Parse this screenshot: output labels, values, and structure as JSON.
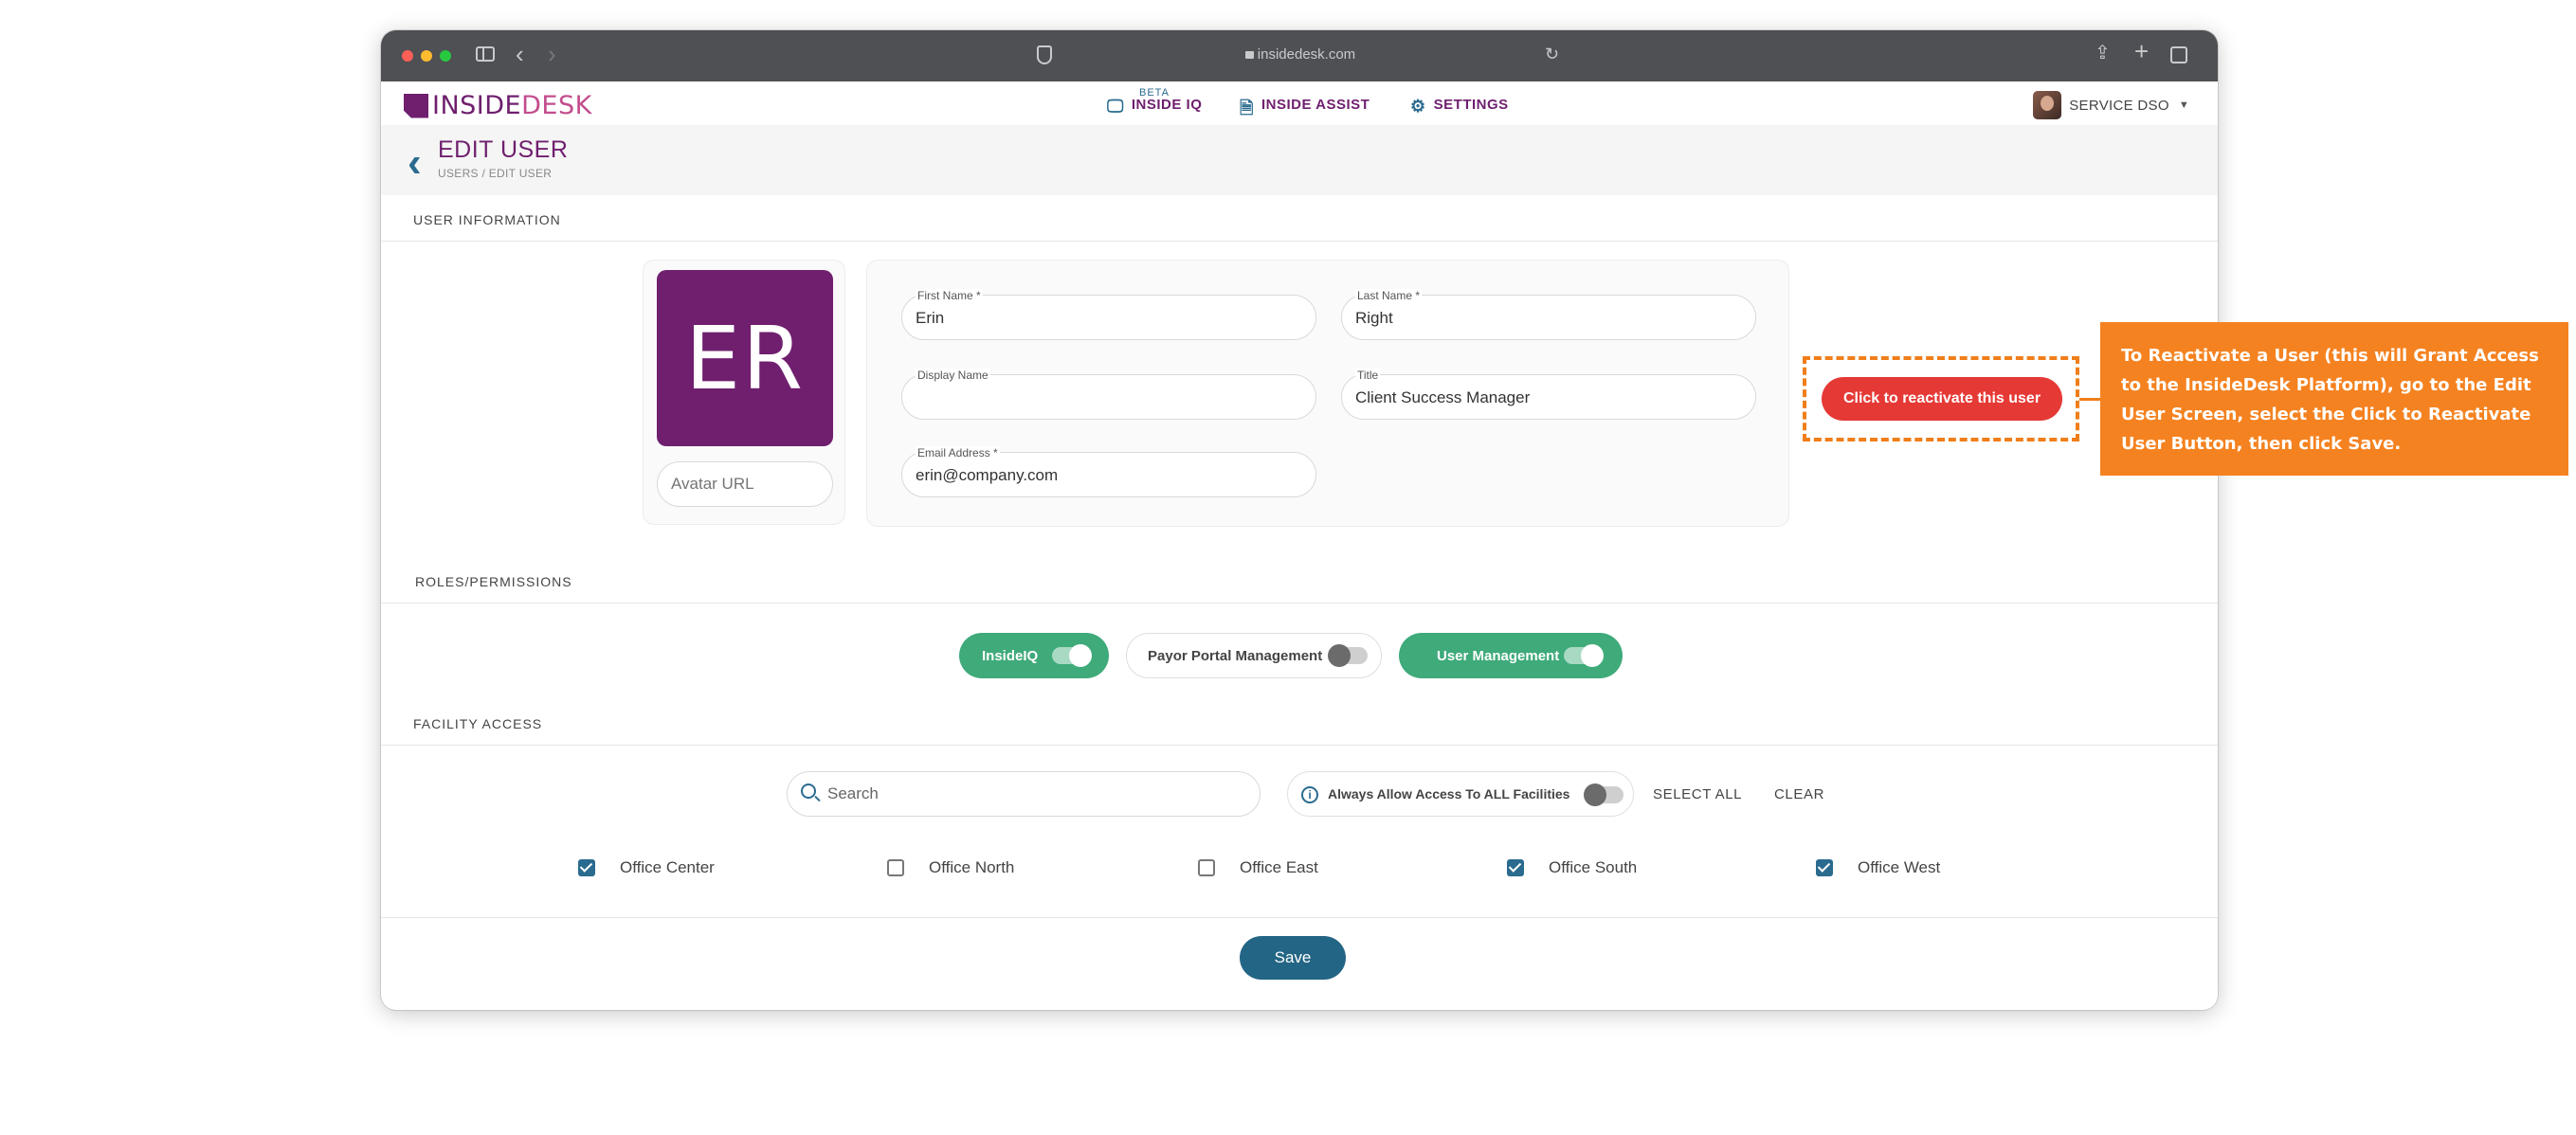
{
  "browser": {
    "url": "insidedesk.com"
  },
  "app": {
    "logo_inside": "INSIDE",
    "logo_desk": "DESK",
    "nav": {
      "beta_badge": "BETA",
      "inside_iq": "INSIDE IQ",
      "inside_assist": "INSIDE ASSIST",
      "settings": "SETTINGS"
    },
    "user_menu": "SERVICE DSO"
  },
  "page": {
    "title": "EDIT USER",
    "breadcrumb": "USERS  / EDIT USER"
  },
  "user_info": {
    "section_label": "USER INFORMATION",
    "avatar_initials": "ER",
    "avatar_url_placeholder": "Avatar URL",
    "first_name_label": "First Name *",
    "first_name": "Erin",
    "last_name_label": "Last Name *",
    "last_name": "Right",
    "display_name_label": "Display Name",
    "display_name": "",
    "title_label": "Title",
    "title": "Client Success Manager",
    "email_label": "Email Address *",
    "email": "erin@company.com",
    "reactivate_button": "Click to reactivate this user"
  },
  "roles": {
    "section_label": "ROLES/PERMISSIONS",
    "items": [
      {
        "label": "InsideIQ",
        "enabled": true
      },
      {
        "label": "Payor Portal Management",
        "enabled": false
      },
      {
        "label": "User Management",
        "enabled": true
      }
    ]
  },
  "facility": {
    "section_label": "FACILITY ACCESS",
    "search_placeholder": "Search",
    "always_allow_label": "Always Allow Access To ALL Facilities",
    "always_allow_enabled": false,
    "select_all": "SELECT ALL",
    "clear": "CLEAR",
    "offices": [
      {
        "label": "Office Center",
        "checked": true
      },
      {
        "label": "Office North",
        "checked": false
      },
      {
        "label": "Office East",
        "checked": false
      },
      {
        "label": "Office South",
        "checked": true
      },
      {
        "label": "Office West",
        "checked": true
      }
    ]
  },
  "save_button": "Save",
  "callout_text": "To Reactivate a User (this will Grant Access to the InsideDesk Platform), go to the Edit User Screen, select the Click to Reactivate User Button, then click Save.",
  "colors": {
    "brand_purple": "#6f1f6e",
    "accent_blue": "#2a6b8f",
    "toggle_green": "#3faa7a",
    "reactivate_red": "#e53935",
    "callout_orange": "#f58220"
  }
}
